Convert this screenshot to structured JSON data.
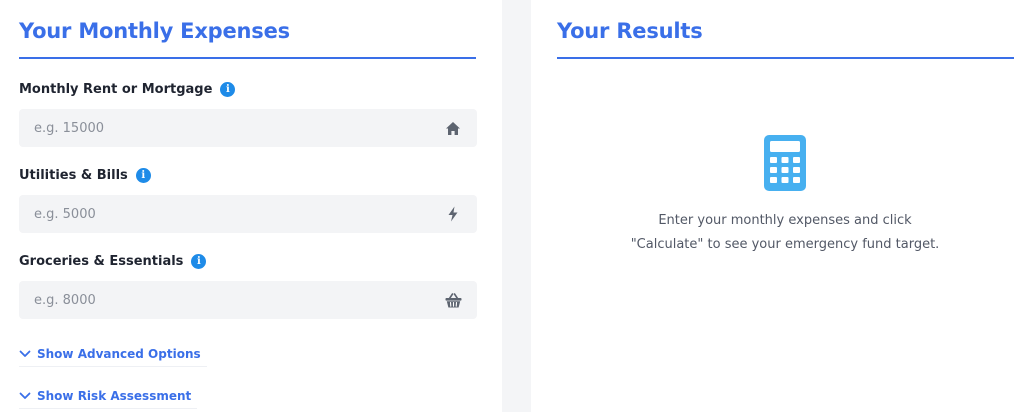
{
  "expenses": {
    "title": "Your Monthly Expenses",
    "fields": [
      {
        "label": "Monthly Rent or Mortgage",
        "placeholder": "e.g. 15000",
        "value": "",
        "icon": "home-icon"
      },
      {
        "label": "Utilities & Bills",
        "placeholder": "e.g. 5000",
        "value": "",
        "icon": "bolt-icon"
      },
      {
        "label": "Groceries & Essentials",
        "placeholder": "e.g. 8000",
        "value": "",
        "icon": "basket-icon"
      }
    ],
    "toggles": [
      {
        "label": "Show Advanced Options",
        "icon": "chevron-down-icon"
      },
      {
        "label": "Show Risk Assessment",
        "icon": "chevron-down-icon"
      }
    ]
  },
  "results": {
    "title": "Your Results",
    "icon": "calculator-icon",
    "message": "Enter your monthly expenses and click \"Calculate\" to see your emergency fund target."
  },
  "colors": {
    "accent": "#3a6fe8",
    "info": "#1e8be8",
    "calculator": "#47b0f0",
    "input_bg": "#f3f4f6",
    "page_bg": "#f4f5f7"
  }
}
